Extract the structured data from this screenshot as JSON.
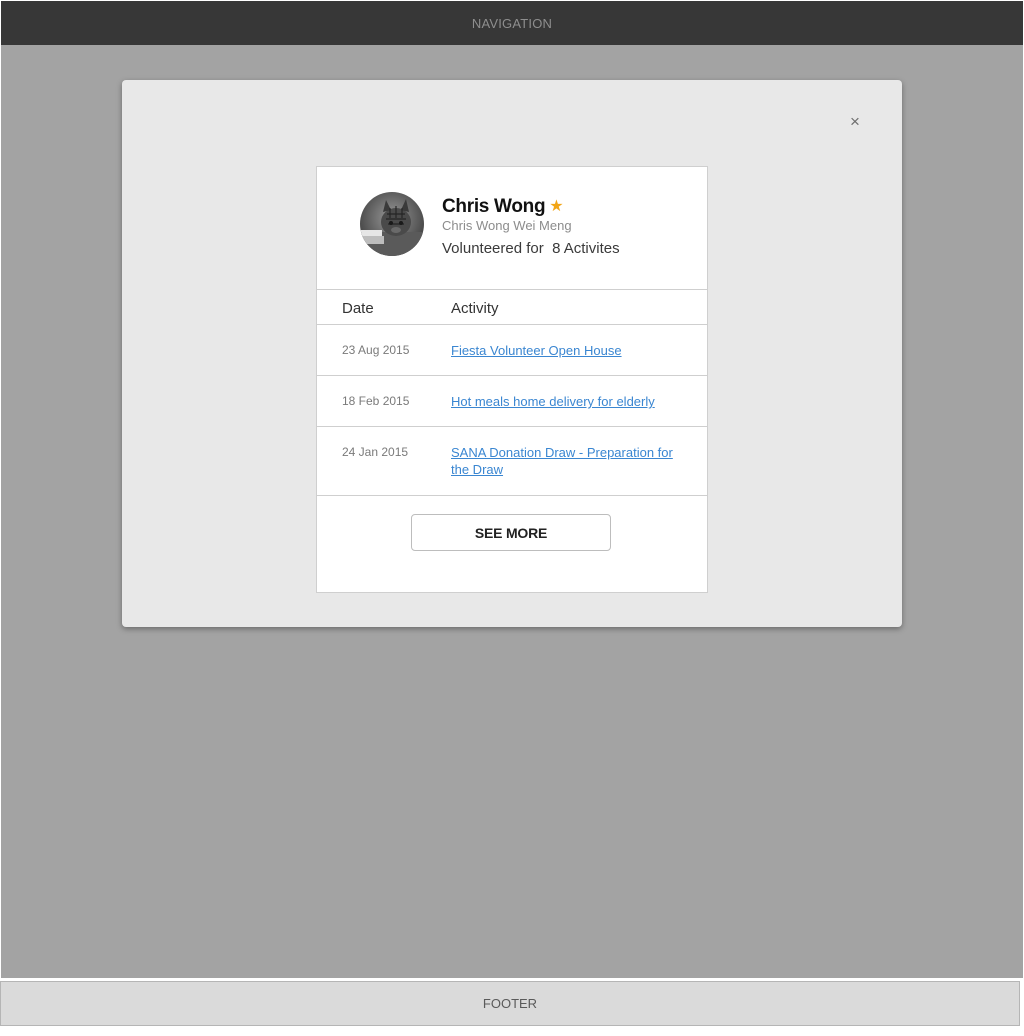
{
  "nav": {
    "label": "NAVIGATION"
  },
  "footer": {
    "label": "FOOTER"
  },
  "modal": {
    "close_label": "×",
    "profile": {
      "name": "Chris Wong",
      "star": "★",
      "full_name": "Chris Wong Wei Meng",
      "volunteered": "Volunteered for  8 Activites"
    },
    "table": {
      "headers": {
        "date": "Date",
        "activity": "Activity"
      },
      "rows": [
        {
          "date": "23 Aug 2015",
          "activity": "Fiesta Volunteer Open House"
        },
        {
          "date": "18 Feb 2015",
          "activity": "Hot meals home delivery for elderly"
        },
        {
          "date": "24 Jan 2015",
          "activity": "SANA Donation Draw - Preparation for the Draw"
        }
      ]
    },
    "see_more_label": "SEE MORE"
  },
  "colors": {
    "nav_bg": "#373737",
    "overlay_bg": "#a3a3a3",
    "modal_bg": "#e8e8e8",
    "link": "#3a86d1",
    "star": "#f2a516"
  },
  "icons": {
    "close": "close-icon",
    "star": "star-icon",
    "avatar": "cat-photo"
  }
}
